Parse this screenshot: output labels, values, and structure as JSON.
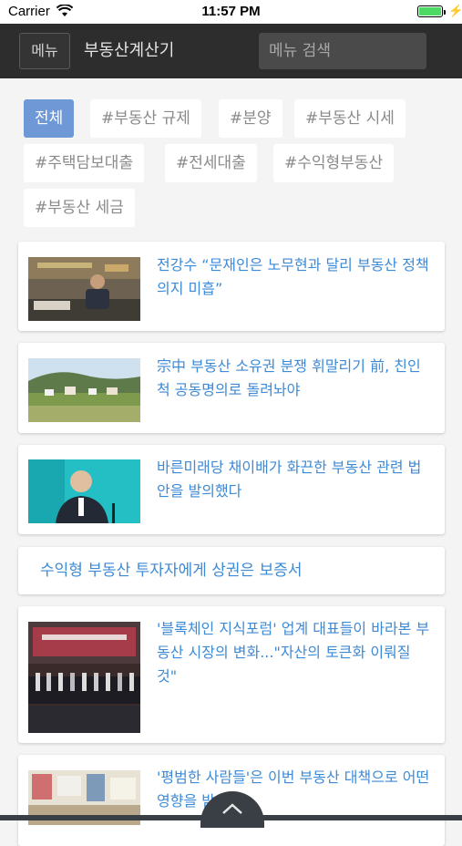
{
  "status_bar": {
    "carrier": "Carrier",
    "time": "11:57 PM",
    "battery_level": 1.0
  },
  "nav": {
    "menu_label": "메뉴",
    "title": "부동산계산기",
    "search_placeholder": "메뉴 검색"
  },
  "tags": [
    "전체",
    "#부동산 규제",
    "#분양",
    "#부동산 시세",
    "#주택담보대출",
    "#전세대출",
    "#수익형부동산",
    "#부동산 세금"
  ],
  "articles": [
    {
      "title": "전강수 “문재인은 노무현과 달리 부동산 정책 의지 미흡”"
    },
    {
      "title": "宗中 부동산 소유권 분쟁 휘말리기 前, 친인척 공동명의로 돌려놔야"
    },
    {
      "title": "바른미래당 채이배가 화끈한 부동산 관련 법안을 발의했다"
    },
    {
      "title": "수익형 부동산 투자자에게 상권은 보증서"
    },
    {
      "title": "'블록체인 지식포럼' 업계 대표들이 바라본 부동산 시장의 변화...\"자산의 토큰화 이뤄질 것\""
    },
    {
      "title": "'평범한 사람들'은 이번 부동산 대책으로 어떤 영향을 받을까?"
    }
  ],
  "colors": {
    "accent": "#6f98d6",
    "link": "#3d8ad6",
    "nav_bg": "#2d2d2d"
  }
}
